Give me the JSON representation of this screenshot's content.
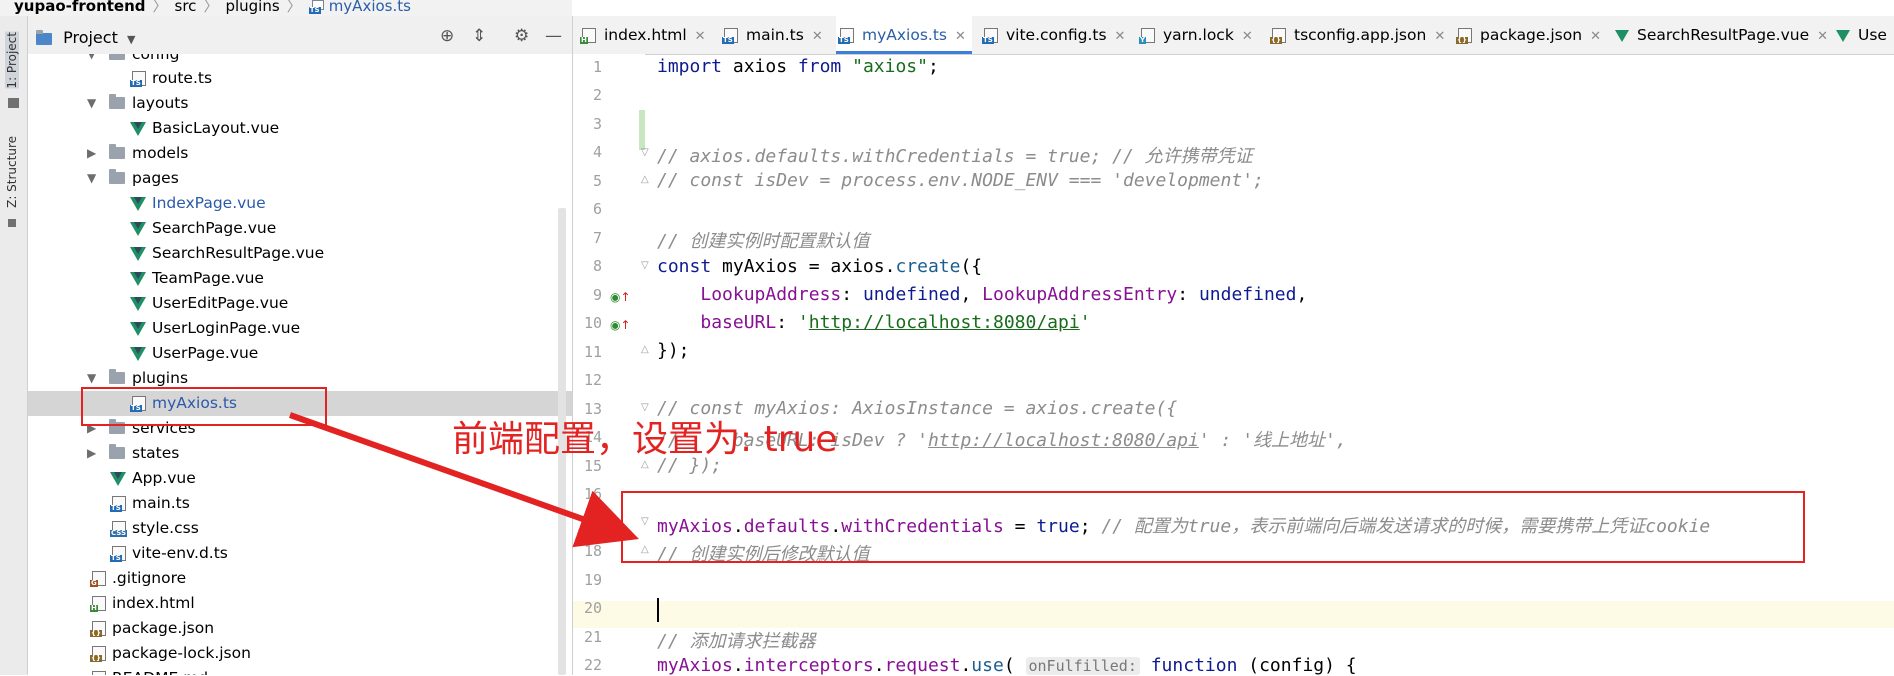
{
  "breadcrumb": {
    "items": [
      "yupao-frontend",
      "src",
      "plugins",
      "myAxios.ts"
    ]
  },
  "tool_strip": {
    "project_tab": "1: Project",
    "structure_tab": "Z: Structure"
  },
  "project_panel": {
    "title": "Project",
    "tree": [
      {
        "label": "config",
        "type": "folder",
        "depth": 1,
        "expanded": true
      },
      {
        "label": "route.ts",
        "type": "ts",
        "depth": 2
      },
      {
        "label": "layouts",
        "type": "folder",
        "depth": 1,
        "expanded": true
      },
      {
        "label": "BasicLayout.vue",
        "type": "vue",
        "depth": 2
      },
      {
        "label": "models",
        "type": "folder",
        "depth": 1,
        "expanded": false
      },
      {
        "label": "pages",
        "type": "folder",
        "depth": 1,
        "expanded": true
      },
      {
        "label": "IndexPage.vue",
        "type": "vue",
        "depth": 2,
        "modified": true
      },
      {
        "label": "SearchPage.vue",
        "type": "vue",
        "depth": 2
      },
      {
        "label": "SearchResultPage.vue",
        "type": "vue",
        "depth": 2
      },
      {
        "label": "TeamPage.vue",
        "type": "vue",
        "depth": 2
      },
      {
        "label": "UserEditPage.vue",
        "type": "vue",
        "depth": 2
      },
      {
        "label": "UserLoginPage.vue",
        "type": "vue",
        "depth": 2
      },
      {
        "label": "UserPage.vue",
        "type": "vue",
        "depth": 2
      },
      {
        "label": "plugins",
        "type": "folder",
        "depth": 1,
        "expanded": true
      },
      {
        "label": "myAxios.ts",
        "type": "ts",
        "depth": 2,
        "selected": true,
        "modified": true
      },
      {
        "label": "services",
        "type": "folder",
        "depth": 1,
        "expanded": false
      },
      {
        "label": "states",
        "type": "folder",
        "depth": 1,
        "expanded": false
      },
      {
        "label": "App.vue",
        "type": "vue",
        "depth": 1
      },
      {
        "label": "main.ts",
        "type": "ts",
        "depth": 1
      },
      {
        "label": "style.css",
        "type": "css",
        "depth": 1
      },
      {
        "label": "vite-env.d.ts",
        "type": "ts",
        "depth": 1
      },
      {
        "label": ".gitignore",
        "type": "git",
        "depth": 0
      },
      {
        "label": "index.html",
        "type": "html",
        "depth": 0
      },
      {
        "label": "package.json",
        "type": "json",
        "depth": 0
      },
      {
        "label": "package-lock.json",
        "type": "json",
        "depth": 0
      },
      {
        "label": "README.md",
        "type": "md",
        "depth": 0
      }
    ]
  },
  "editor_tabs": [
    {
      "label": "index.html",
      "icon": "html",
      "active": false
    },
    {
      "label": "main.ts",
      "icon": "ts",
      "active": false
    },
    {
      "label": "myAxios.ts",
      "icon": "ts",
      "active": true
    },
    {
      "label": "vite.config.ts",
      "icon": "ts",
      "active": false
    },
    {
      "label": "yarn.lock",
      "icon": "yarn",
      "active": false
    },
    {
      "label": "tsconfig.app.json",
      "icon": "json",
      "active": false
    },
    {
      "label": "package.json",
      "icon": "json",
      "active": false
    },
    {
      "label": "SearchResultPage.vue",
      "icon": "vue",
      "active": false
    },
    {
      "label": "Use",
      "icon": "vue",
      "active": false
    }
  ],
  "code": {
    "line_numbers": [
      "1",
      "2",
      "3",
      "4",
      "5",
      "6",
      "7",
      "8",
      "9",
      "10",
      "11",
      "12",
      "13",
      "14",
      "15",
      "16",
      "17",
      "18",
      "19",
      "20",
      "21",
      "22"
    ],
    "line1": {
      "k": "import",
      "id": "axios",
      "k2": "from",
      "s": "\"axios\"",
      "p": ";"
    },
    "line4": "// axios.defaults.withCredentials = true; // 允许携带凭证",
    "line5": "// const isDev = process.env.NODE_ENV === 'development';",
    "line7": "// 创建实例时配置默认值",
    "line8": {
      "k": "const",
      "id": "myAxios",
      "eq": " = ",
      "obj": "axios",
      "fn": "create",
      "tail": "({"
    },
    "line9": {
      "p1": "LookupAddress",
      "v1": "undefined",
      "p2": "LookupAddressEntry",
      "v2": "undefined"
    },
    "line10": {
      "p": "baseURL",
      "url": "http://localhost:8080/api"
    },
    "line11": "});",
    "line13": "// const myAxios: AxiosInstance = axios.create({",
    "line14": {
      "a": "//     baseURL: isDev ? '",
      "url": "http://localhost:8080/api",
      "b": "' : '线上地址',"
    },
    "line15": "// });",
    "line17": {
      "obj": "myAxios",
      "p1": "defaults",
      "p2": "withCredentials",
      "eq": " = ",
      "v": "true",
      "semi": "; ",
      "cmt": "// 配置为true，表示前端向后端发送请求的时候，需要携带上凭证cookie"
    },
    "line18": "// 创建实例后修改默认值",
    "line21": "// 添加请求拦截器",
    "line22": {
      "obj": "myAxios",
      "p1": "interceptors",
      "p2": "request",
      "fn": "use",
      "hint": "onFulfilled:",
      "k": "function",
      "tail": " (config) {"
    }
  },
  "annotation": {
    "text": "前端配置，设置为: true",
    "color": "#e32222"
  },
  "colors": {
    "accent": "#3d7ed8",
    "keyword": "#0e1a8f",
    "string": "#176c1a",
    "comment": "#8c8c8c",
    "property": "#871094",
    "annotation_red": "#e32222"
  }
}
